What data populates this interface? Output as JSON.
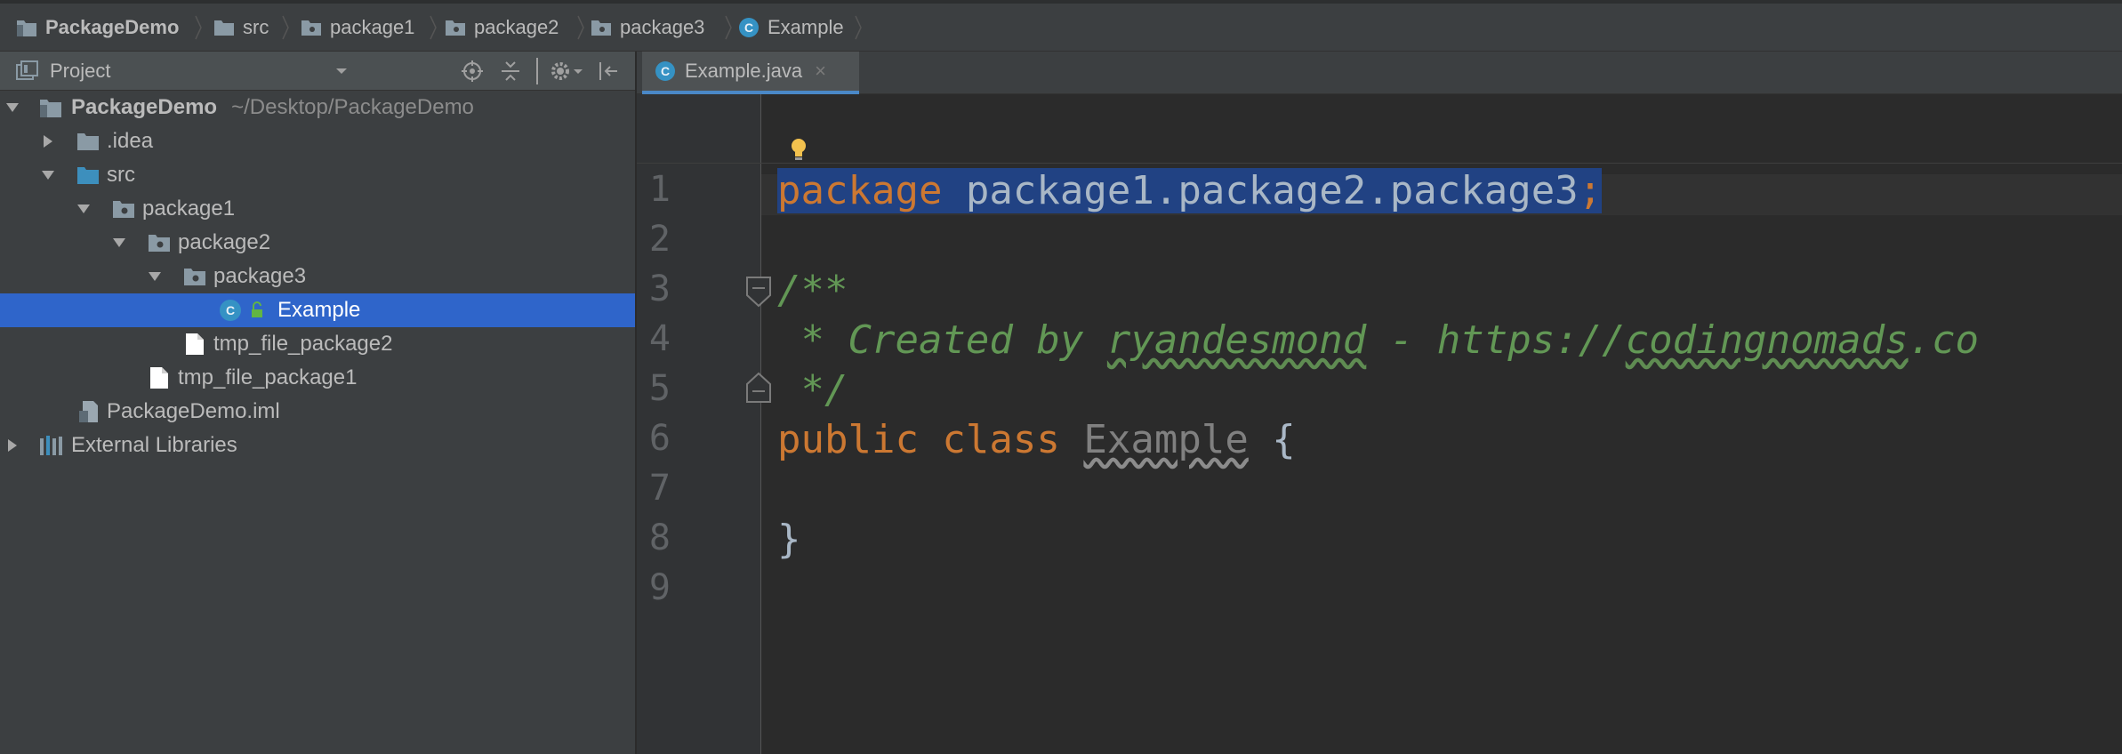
{
  "breadcrumbs": [
    {
      "label": "PackageDemo",
      "icon": "project-folder-icon"
    },
    {
      "label": "src",
      "icon": "folder-icon"
    },
    {
      "label": "package1",
      "icon": "package-icon"
    },
    {
      "label": "package2",
      "icon": "package-icon"
    },
    {
      "label": "package3",
      "icon": "package-icon"
    },
    {
      "label": "Example",
      "icon": "class-icon"
    }
  ],
  "project_panel": {
    "title": "Project",
    "tree": [
      {
        "label": "PackageDemo",
        "hint": "~/Desktop/PackageDemo",
        "icon": "project-folder-icon",
        "expanded": true,
        "depth": 0
      },
      {
        "label": ".idea",
        "icon": "folder-icon",
        "expanded": false,
        "depth": 1
      },
      {
        "label": "src",
        "icon": "source-folder-icon",
        "expanded": true,
        "depth": 1
      },
      {
        "label": "package1",
        "icon": "package-icon",
        "expanded": true,
        "depth": 2
      },
      {
        "label": "package2",
        "icon": "package-icon",
        "expanded": true,
        "depth": 3
      },
      {
        "label": "package3",
        "icon": "package-icon",
        "expanded": true,
        "depth": 4
      },
      {
        "label": "Example",
        "icon": "class-icon",
        "selected": true,
        "depth": 5
      },
      {
        "label": "tmp_file_package2",
        "icon": "file-icon",
        "depth": 4
      },
      {
        "label": "tmp_file_package1",
        "icon": "file-icon",
        "depth": 3
      },
      {
        "label": "PackageDemo.iml",
        "icon": "iml-file-icon",
        "depth": 1
      },
      {
        "label": "External Libraries",
        "icon": "libraries-icon",
        "expanded": false,
        "depth": 0
      }
    ]
  },
  "editor": {
    "tab_label": "Example.java",
    "line_numbers": [
      "1",
      "2",
      "3",
      "4",
      "5",
      "6",
      "7",
      "8",
      "9"
    ],
    "code": {
      "l1_kw": "package",
      "l1_rest": " package1.package2.package3",
      "l1_semi": ";",
      "l3": "/**",
      "l4_a": " * Created by ",
      "l4_b": "ryandesmond",
      "l4_c": " - https://",
      "l4_d": "codingnomads",
      "l4_e": ".co",
      "l5": " */",
      "l6_kw": "public class ",
      "l6_name": "Example",
      "l6_brace": " {",
      "l8": "}"
    }
  },
  "colors": {
    "background": "#2b2b2b",
    "panel": "#3c3f41",
    "selection": "#2f65ca",
    "keyword": "#cc7832",
    "comment": "#629755",
    "identifier": "#a9b7c6"
  }
}
